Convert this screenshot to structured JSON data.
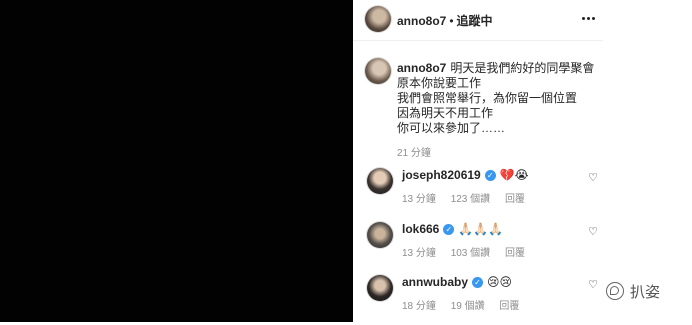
{
  "post": {
    "author": "anno8o7",
    "header_separator": "•",
    "follow_status": "追蹤中",
    "caption": {
      "author": "anno8o7",
      "lines": [
        "明天是我們約好的同學聚會",
        "原本你說要工作",
        "我們會照常舉行，為你留一個位置",
        "因為明天不用工作",
        "你可以來參加了……"
      ],
      "time": "21 分鐘"
    }
  },
  "comments": [
    {
      "username": "joseph820619",
      "verified": true,
      "text": "💔😭",
      "time": "13 分鐘",
      "likes": "123 個讚",
      "reply": "回覆"
    },
    {
      "username": "lok666",
      "verified": true,
      "text": "🙏🏻🙏🏻🙏🏻",
      "time": "13 分鐘",
      "likes": "103 個讚",
      "reply": "回覆"
    },
    {
      "username": "annwubaby",
      "verified": true,
      "text": "😢😢",
      "time": "18 分鐘",
      "likes": "19 個讚",
      "reply": "回覆"
    }
  ],
  "icons": {
    "verified": "verified-badge-icon",
    "like": "heart-outline-icon",
    "more": "more-options-icon"
  },
  "watermark": {
    "text": "扒姿"
  },
  "colors": {
    "media_bg": "#020202",
    "verified": "#3897f0",
    "meta_text": "#8e8e8e"
  }
}
